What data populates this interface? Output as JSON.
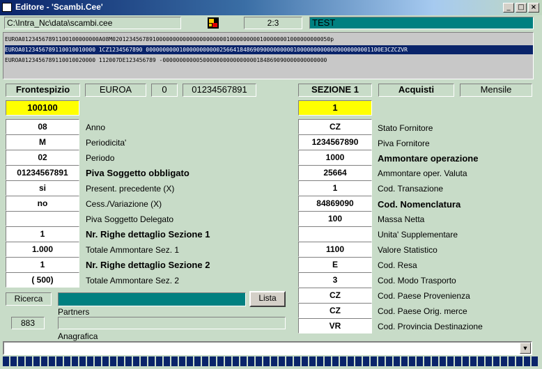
{
  "window": {
    "title": "Editore - 'Scambi.Cee'",
    "minimize": "_",
    "maximize": "□",
    "close": "×"
  },
  "toolbar": {
    "path": "C:\\Intra_Nc\\data\\scambi.cee",
    "page": "2:3",
    "mode": "TEST"
  },
  "records": [
    "EUROA01234567891100100000000A08M02012345678910000000000000000000001000000000100000001000000000050p",
    "EUROA0123456789110010010000 1CZ1234567890    0000000000100000000000256641848690900000000010000000000000000000001100E3CZCZVR",
    "EUROA0123456789110010020000 112007DE123456789     -0000000000050000000000000000184869090000000000000"
  ],
  "left": {
    "header": "Frontespizio",
    "code": "EUROA",
    "num": "0",
    "piva": "01234567891",
    "yellow_value": "100100",
    "fields": [
      {
        "value": "08",
        "label": "Anno"
      },
      {
        "value": "M",
        "label": "Periodicita'"
      },
      {
        "value": "02",
        "label": "Periodo"
      },
      {
        "value": "01234567891",
        "label": "Piva Soggetto obbligato"
      },
      {
        "value": "si",
        "label": "Present. precedente (X)"
      },
      {
        "value": "no",
        "label": "Cess./Variazione (X)"
      },
      {
        "value": "",
        "label": "Piva Soggetto Delegato"
      },
      {
        "value": "1",
        "label": "Nr. Righe dettaglio Sezione 1"
      },
      {
        "value": "1.000",
        "label": "Totale Ammontare Sez. 1"
      },
      {
        "value": "1",
        "label": "Nr. Righe dettaglio Sezione 2"
      },
      {
        "value": "( 500)",
        "label": "Totale Ammontare Sez. 2"
      }
    ]
  },
  "right": {
    "header": "SEZIONE 1",
    "type": "Acquisti",
    "periodicity": "Mensile",
    "yellow_value": "1",
    "fields": [
      {
        "value": "CZ",
        "label": "Stato Fornitore"
      },
      {
        "value": "1234567890",
        "label": "Piva Fornitore"
      },
      {
        "value": "1000",
        "label": "Ammontare operazione"
      },
      {
        "value": "25664",
        "label": "Ammontare oper. Valuta"
      },
      {
        "value": "1",
        "label": "Cod. Transazione"
      },
      {
        "value": "84869090",
        "label": "Cod. Nomenclatura"
      },
      {
        "value": "100",
        "label": "Massa Netta"
      },
      {
        "value": "",
        "label": "Unita' Supplementare"
      },
      {
        "value": "1100",
        "label": "Valore Statistico"
      },
      {
        "value": "E",
        "label": "Cod. Resa"
      },
      {
        "value": "3",
        "label": "Cod. Modo Trasporto"
      },
      {
        "value": "CZ",
        "label": "Cod. Paese Provenienza"
      },
      {
        "value": "CZ",
        "label": "Cod. Paese Orig. merce"
      },
      {
        "value": "VR",
        "label": "Cod. Provincia Destinazione"
      }
    ]
  },
  "search": {
    "label": "Ricerca",
    "value": "",
    "list_button": "Lista",
    "partners_label": "Partners",
    "count": "883",
    "partners_value": "",
    "anagrafica_label": "Anagrafica"
  },
  "bottom": {
    "value": ""
  },
  "colors": {
    "background": "#c8dcc8",
    "highlight": "#ffff00",
    "selection": "#0a246a",
    "accent": "#008080"
  }
}
